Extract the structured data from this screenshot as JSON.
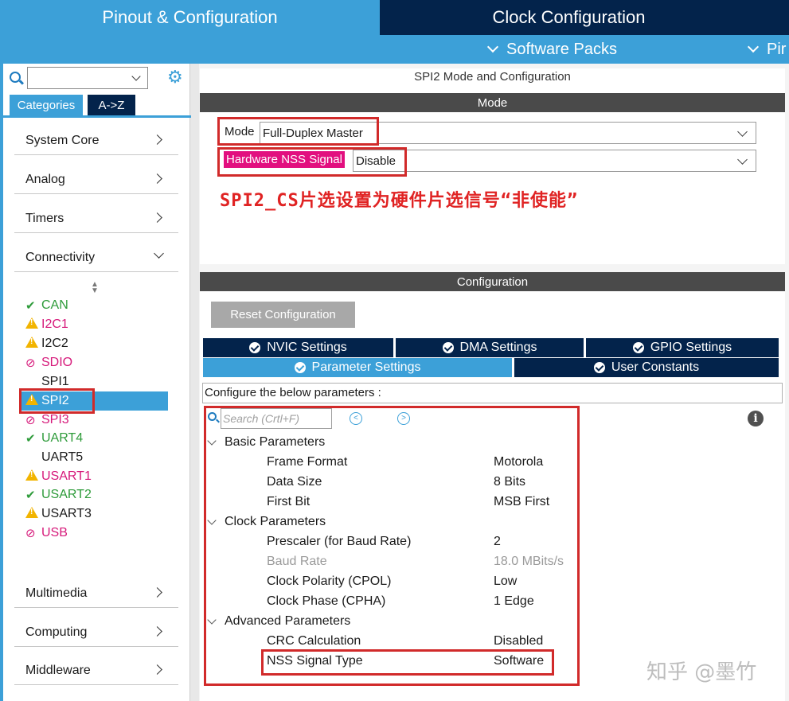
{
  "top_tabs": {
    "pinout": "Pinout & Configuration",
    "clock": "Clock Configuration"
  },
  "sub_bar": {
    "software_packs": "Software Packs",
    "pinout_truncated": "Pir"
  },
  "sidebar": {
    "search_value": "",
    "tabs": [
      "Categories",
      "A->Z"
    ],
    "categories": [
      {
        "label": "System Core",
        "expanded": false
      },
      {
        "label": "Analog",
        "expanded": false
      },
      {
        "label": "Timers",
        "expanded": false
      },
      {
        "label": "Connectivity",
        "expanded": true
      },
      {
        "label": "Multimedia",
        "expanded": false
      },
      {
        "label": "Computing",
        "expanded": false
      },
      {
        "label": "Middleware",
        "expanded": false
      }
    ],
    "peripherals": [
      {
        "label": "CAN",
        "status": "ok"
      },
      {
        "label": "I2C1",
        "status": "warning"
      },
      {
        "label": "I2C2",
        "status": "warning"
      },
      {
        "label": "SDIO",
        "status": "disabled"
      },
      {
        "label": "SPI1",
        "status": "none"
      },
      {
        "label": "SPI2",
        "status": "warning",
        "selected": true
      },
      {
        "label": "SPI3",
        "status": "disabled"
      },
      {
        "label": "UART4",
        "status": "ok"
      },
      {
        "label": "UART5",
        "status": "none"
      },
      {
        "label": "USART1",
        "status": "warning"
      },
      {
        "label": "USART2",
        "status": "ok"
      },
      {
        "label": "USART3",
        "status": "warning"
      },
      {
        "label": "USB",
        "status": "disabled"
      }
    ]
  },
  "mode_panel": {
    "title": "SPI2 Mode and Configuration",
    "section": "Mode",
    "mode_label": "Mode",
    "mode_value": "Full-Duplex Master",
    "nss_label": "Hardware NSS Signal",
    "nss_value": "Disable",
    "annotation": "SPI2_CS片选设置为硬件片选信号“非使能”"
  },
  "config_panel": {
    "section": "Configuration",
    "reset_button": "Reset Configuration",
    "tabs_row1": [
      "NVIC Settings",
      "DMA Settings",
      "GPIO Settings"
    ],
    "tabs_row2": [
      "Parameter Settings",
      "User Constants"
    ],
    "active_tab": "Parameter Settings",
    "hint": "Configure the below parameters :",
    "search_placeholder": "Search (Crtl+F)",
    "groups": [
      {
        "name": "Basic Parameters",
        "params": [
          {
            "name": "Frame Format",
            "value": "Motorola"
          },
          {
            "name": "Data Size",
            "value": "8 Bits"
          },
          {
            "name": "First Bit",
            "value": "MSB First"
          }
        ]
      },
      {
        "name": "Clock Parameters",
        "params": [
          {
            "name": "Prescaler (for Baud Rate)",
            "value": "2"
          },
          {
            "name": "Baud Rate",
            "value": "18.0 MBits/s",
            "readonly": true
          },
          {
            "name": "Clock Polarity (CPOL)",
            "value": "Low"
          },
          {
            "name": "Clock Phase (CPHA)",
            "value": "1 Edge"
          }
        ]
      },
      {
        "name": "Advanced Parameters",
        "params": [
          {
            "name": "CRC Calculation",
            "value": "Disabled"
          },
          {
            "name": "NSS Signal Type",
            "value": "Software"
          }
        ]
      }
    ]
  },
  "watermark": "知乎 @墨竹",
  "colors": {
    "accent": "#3ca0d8",
    "navy": "#03234b",
    "annotation_red": "#d12a2a",
    "nss_pink": "#e20f7f",
    "ok_green": "#2e9b3a",
    "warning_yellow": "#f2b400",
    "disabled_pink": "#d6197a"
  }
}
